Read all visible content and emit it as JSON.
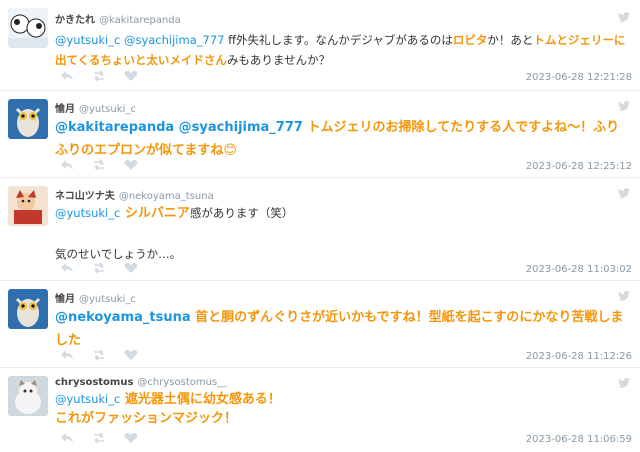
{
  "colors": {
    "mention": "#1b95e0",
    "highlight": "#f5960a",
    "meta": "#8899a6",
    "divider": "#e6ecf0"
  },
  "icons": {
    "reply": "reply-icon",
    "retweet": "retweet-icon",
    "like": "heart-icon",
    "bird": "bird-icon"
  },
  "tweets": [
    {
      "name": "かきたれ",
      "handle": "@kakitarepanda",
      "segments": [
        {
          "t": "@yutsuki_c @syachijima_777",
          "c": "mention"
        },
        {
          "t": " ff外失礼します。なんかデジャブがあるのは",
          "c": ""
        },
        {
          "t": "ロビタ",
          "c": "hl"
        },
        {
          "t": "か！あと",
          "c": ""
        },
        {
          "t": "トムとジェリーに出てくるちょいと太いメイドさん",
          "c": "hl"
        },
        {
          "t": "みもありませんか？",
          "c": ""
        }
      ],
      "date": "2023-06-28 12:21:28"
    },
    {
      "name": "愉月",
      "handle": "@yutsuki_c",
      "segments": [
        {
          "t": "@kakitarepanda @syachijima_777",
          "c": "mention big"
        },
        {
          "t": " トムジェリのお掃除してたりする人ですよね〜！ふりふりのエプロンが似てますね😊",
          "c": "hl big"
        }
      ],
      "date": "2023-06-28 12:25:12"
    },
    {
      "name": "ネコ山ツナ夫",
      "handle": "@nekoyama_tsuna",
      "segments": [
        {
          "t": "@yutsuki_c",
          "c": "mention"
        },
        {
          "t": " シルバニア",
          "c": "hl"
        },
        {
          "t": "感があります（笑）",
          "c": ""
        }
      ],
      "line2": "気のせいでしょうか…。",
      "date": "2023-06-28 11:03:02"
    },
    {
      "name": "愉月",
      "handle": "@yutsuki_c",
      "segments": [
        {
          "t": "@nekoyama_tsuna",
          "c": "mention big"
        },
        {
          "t": " 首と胴のずんぐりさが近いかもですね！型紙を起こすのにかなり苦戦しました",
          "c": "hl big"
        }
      ],
      "date": "2023-06-28 11:12:26"
    },
    {
      "name": "chrysostomus",
      "handle": "@chrysostomus__",
      "segments": [
        {
          "t": "@yutsuki_c",
          "c": "mention"
        },
        {
          "t": " 遮光器土偶に幼女感ある！",
          "c": "hl"
        }
      ],
      "line2": "これがファッションマジック！",
      "line2class": "hl",
      "date": "2023-06-28 11:06:59"
    }
  ]
}
